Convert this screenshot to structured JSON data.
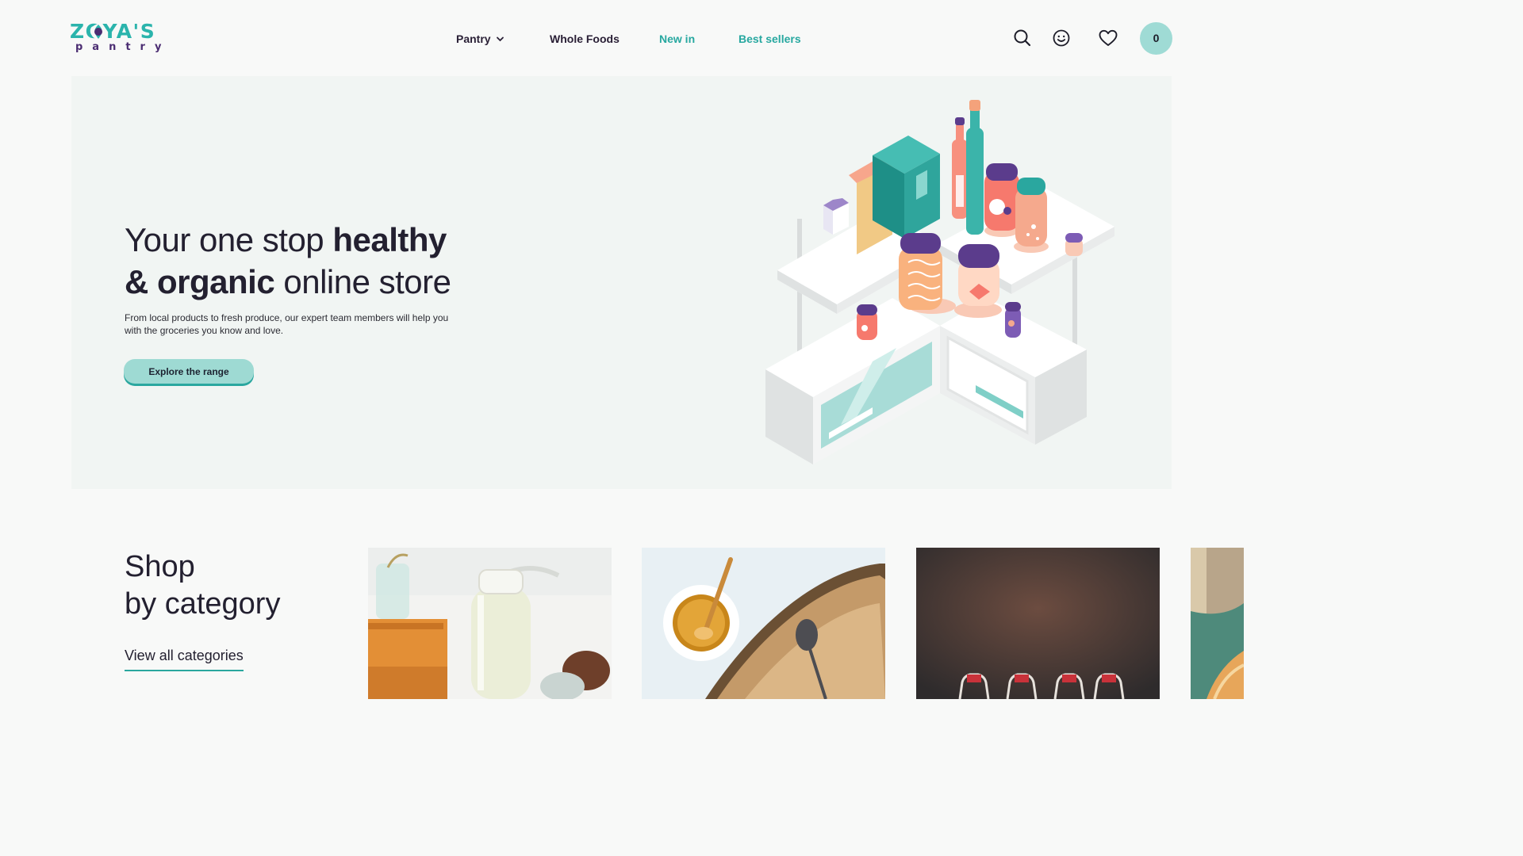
{
  "brand": {
    "name": "ZOYA'S",
    "sub": "pantry"
  },
  "nav": {
    "items": [
      {
        "label": "Pantry",
        "has_dropdown": true
      },
      {
        "label": "Whole Foods"
      },
      {
        "label": "New in"
      },
      {
        "label": "Best sellers"
      }
    ]
  },
  "header_icons": [
    "search-icon",
    "account-smiley-icon",
    "wishlist-heart-icon"
  ],
  "cart": {
    "count": "0"
  },
  "hero": {
    "title_part1": "Your one stop ",
    "title_bold1": "healthy",
    "title_bold2": "& organic",
    "title_part2": " online store",
    "description": "From local products to fresh produce, our expert team members will help you with the groceries you know and love.",
    "cta": "Explore the range"
  },
  "categories_section": {
    "title_line1": "Shop",
    "title_line2": "by category",
    "view_all": "View all categories"
  },
  "colors": {
    "teal": "#2bb4ac",
    "teal_light": "#9edad3",
    "purple": "#4b2d72",
    "text_dark": "#232030",
    "hero_bg": "#f1f5f3"
  }
}
